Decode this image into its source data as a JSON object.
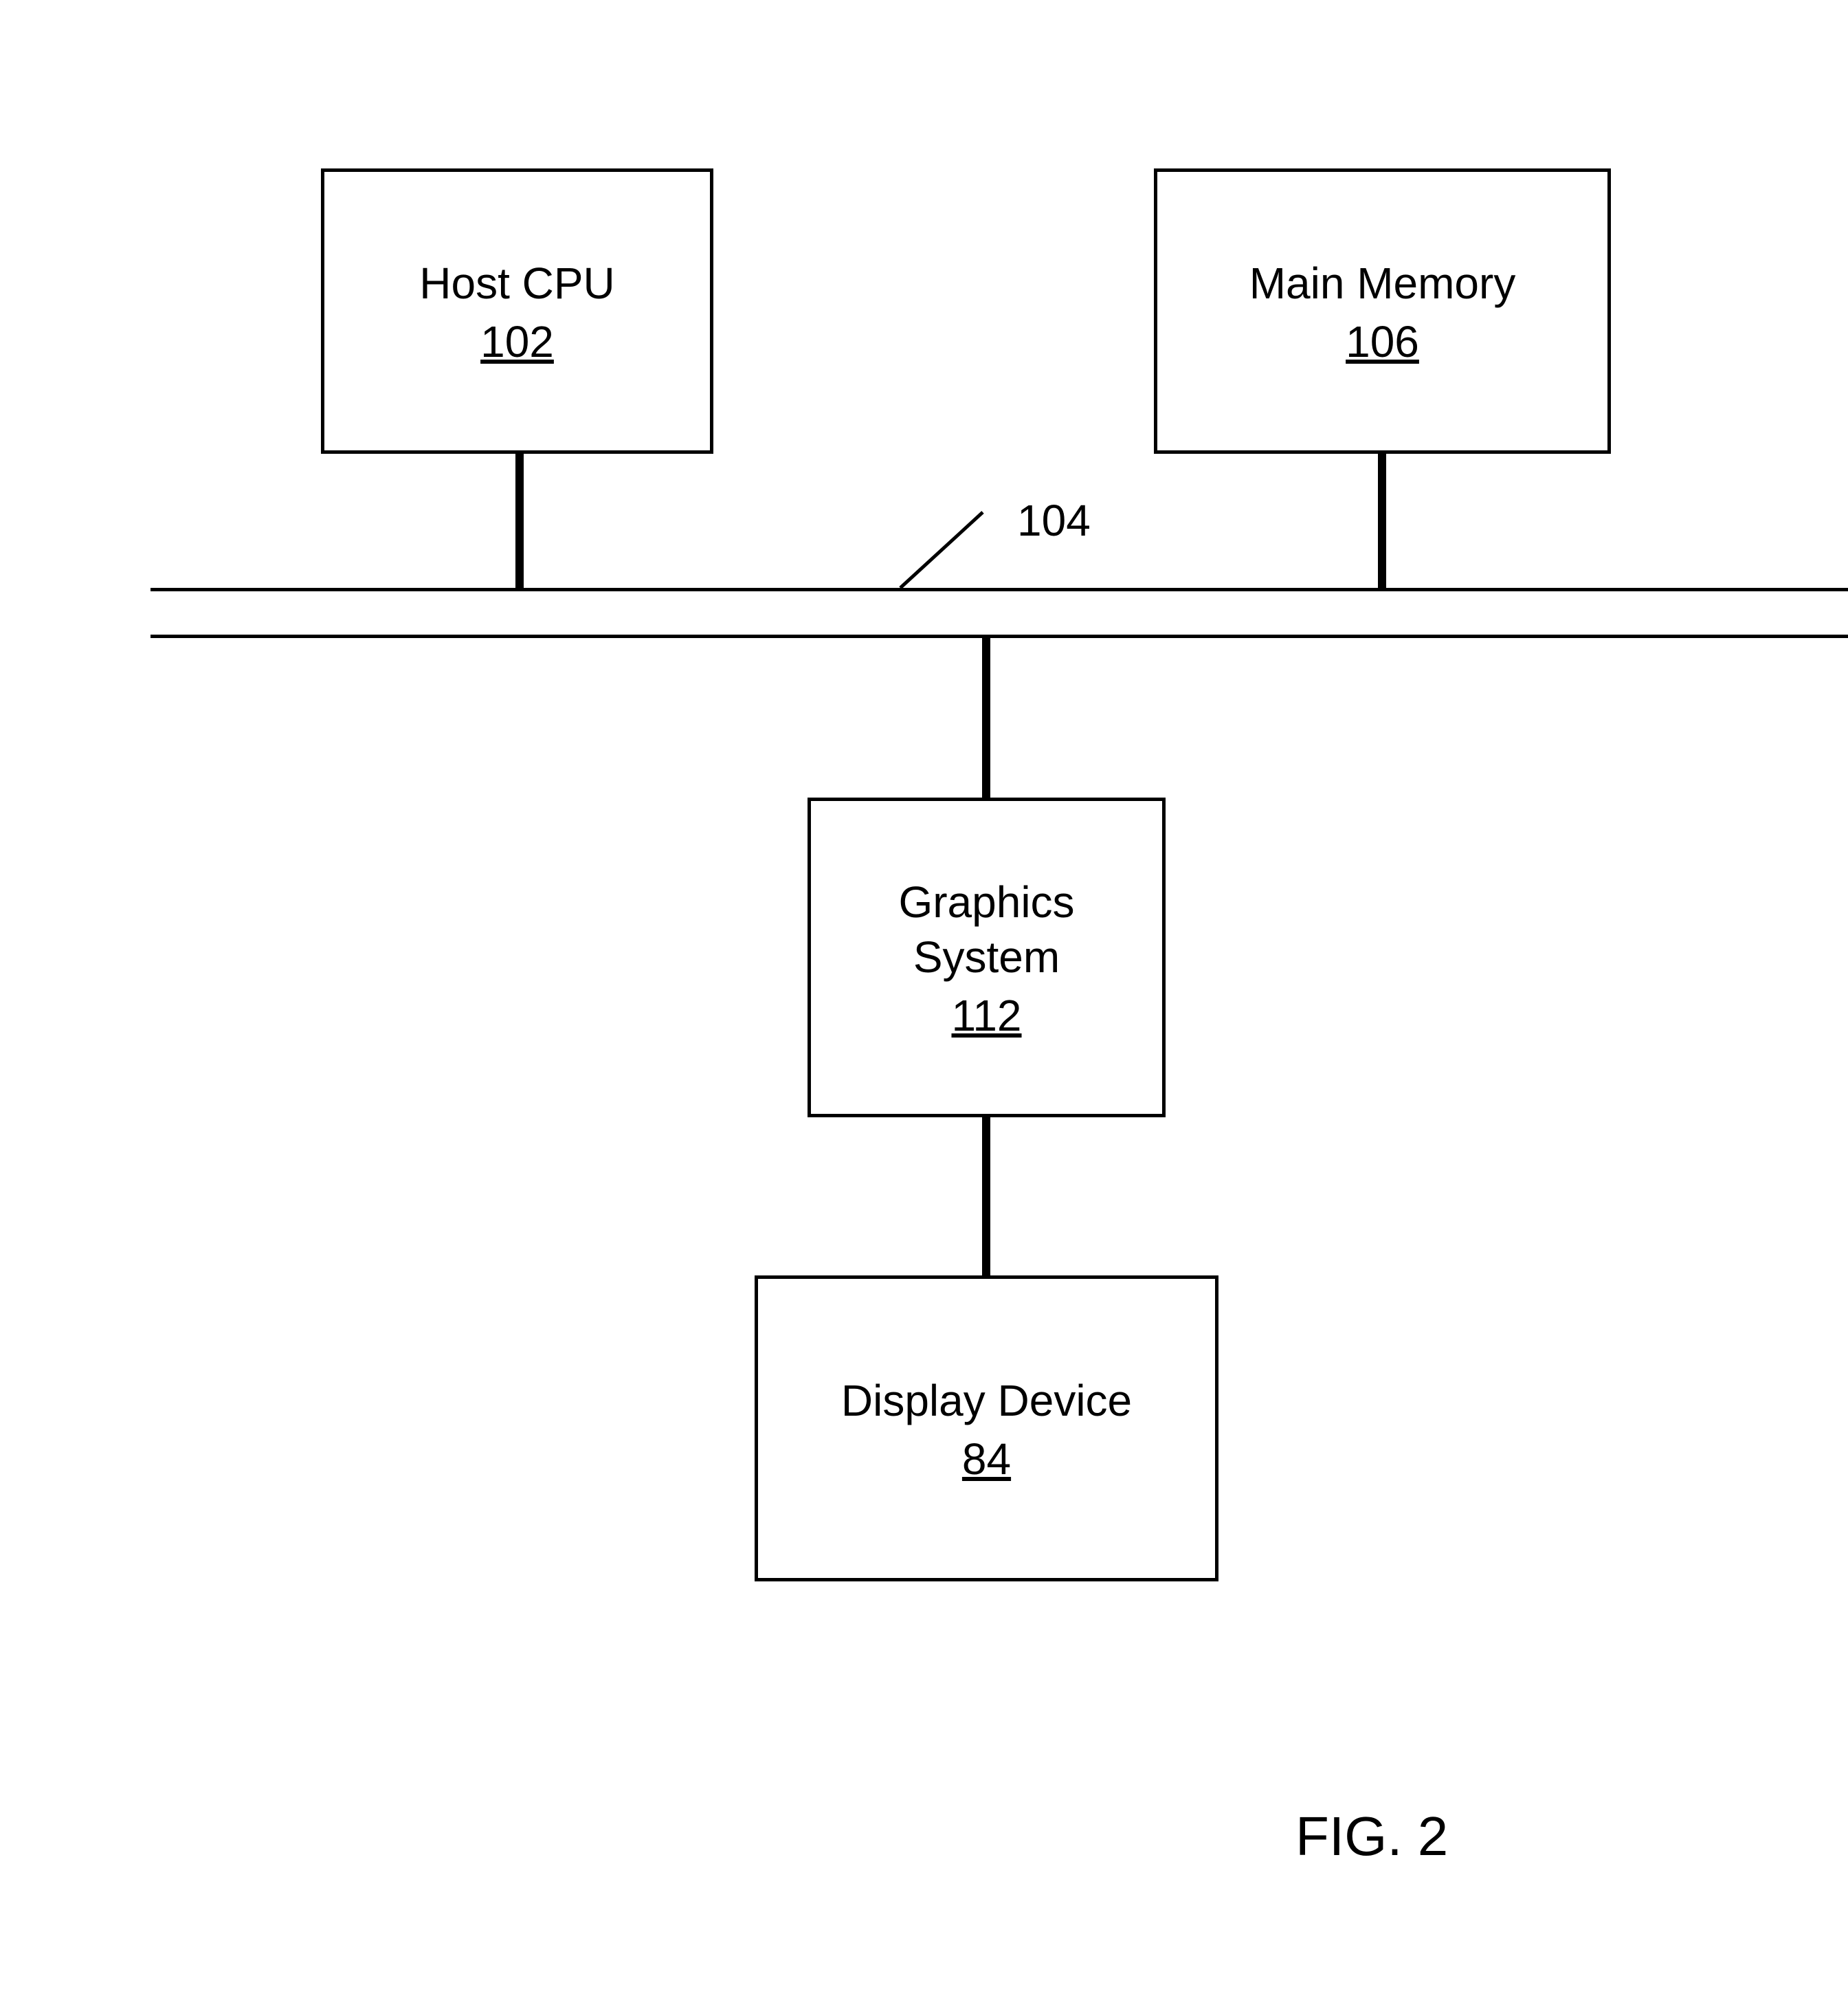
{
  "blocks": {
    "host_cpu": {
      "label": "Host CPU",
      "num": "102"
    },
    "main_memory": {
      "label": "Main Memory",
      "num": "106"
    },
    "graphics_system": {
      "label": "Graphics\nSystem",
      "num": "112"
    },
    "display_device": {
      "label": "Display Device",
      "num": "84"
    }
  },
  "bus": {
    "callout": "104"
  },
  "figure": {
    "label": "FIG. 2"
  }
}
